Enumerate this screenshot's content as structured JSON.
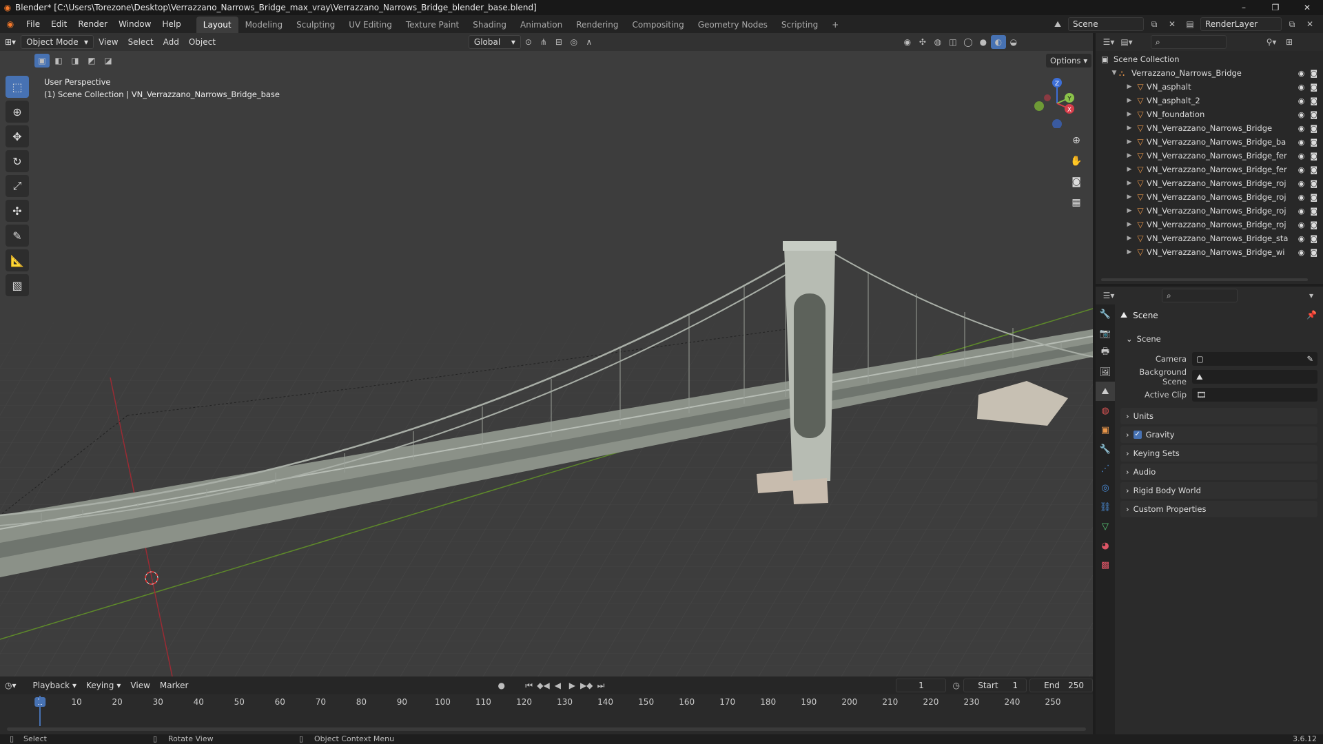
{
  "window": {
    "title": "Blender* [C:\\Users\\Torezone\\Desktop\\Verrazzano_Narrows_Bridge_max_vray\\Verrazzano_Narrows_Bridge_blender_base.blend]",
    "controls": [
      "–",
      "❐",
      "✕"
    ]
  },
  "menubar": {
    "items": [
      "File",
      "Edit",
      "Render",
      "Window",
      "Help"
    ],
    "workspaces": [
      "Layout",
      "Modeling",
      "Sculpting",
      "UV Editing",
      "Texture Paint",
      "Shading",
      "Animation",
      "Rendering",
      "Compositing",
      "Geometry Nodes",
      "Scripting"
    ],
    "active_workspace": "Layout",
    "add_tab": "+",
    "scene_name": "Scene",
    "view_layer": "RenderLayer"
  },
  "viewport": {
    "mode": "Object Mode",
    "menus": [
      "View",
      "Select",
      "Add",
      "Object"
    ],
    "orientation": "Global",
    "options_label": "Options",
    "overlay_line1": "User Perspective",
    "overlay_line2": "(1) Scene Collection | VN_Verrazzano_Narrows_Bridge_base",
    "gizmo_axes": {
      "x": "X",
      "y": "Y",
      "z": "Z"
    }
  },
  "toolbar": {
    "tools": [
      "select-box",
      "cursor",
      "move",
      "rotate",
      "scale",
      "transform",
      "annotate",
      "measure",
      "add-cube"
    ]
  },
  "outliner": {
    "root": "Scene Collection",
    "collection": "Verrazzano_Narrows_Bridge",
    "objects": [
      "VN_asphalt",
      "VN_asphalt_2",
      "VN_foundation",
      "VN_Verrazzano_Narrows_Bridge",
      "VN_Verrazzano_Narrows_Bridge_ba",
      "VN_Verrazzano_Narrows_Bridge_fer",
      "VN_Verrazzano_Narrows_Bridge_fer",
      "VN_Verrazzano_Narrows_Bridge_roj",
      "VN_Verrazzano_Narrows_Bridge_roj",
      "VN_Verrazzano_Narrows_Bridge_roj",
      "VN_Verrazzano_Narrows_Bridge_roj",
      "VN_Verrazzano_Narrows_Bridge_sta",
      "VN_Verrazzano_Narrows_Bridge_wi"
    ]
  },
  "properties": {
    "context_title": "Scene",
    "section_scene": "Scene",
    "camera_label": "Camera",
    "camera_value": "",
    "background_label": "Background Scene",
    "background_value": "",
    "clip_label": "Active Clip",
    "clip_value": "",
    "panels": [
      "Units",
      "Gravity",
      "Keying Sets",
      "Audio",
      "Rigid Body World",
      "Custom Properties"
    ]
  },
  "timeline": {
    "menus": [
      "Playback",
      "Keying",
      "View",
      "Marker"
    ],
    "current_frame": "1",
    "start_label": "Start",
    "start_value": "1",
    "end_label": "End",
    "end_value": "250",
    "ticks": [
      "1",
      "10",
      "20",
      "30",
      "40",
      "50",
      "60",
      "70",
      "80",
      "90",
      "100",
      "110",
      "120",
      "130",
      "140",
      "150",
      "160",
      "170",
      "180",
      "190",
      "200",
      "210",
      "220",
      "230",
      "240",
      "250"
    ]
  },
  "statusbar": {
    "select": "Select",
    "rotate": "Rotate View",
    "context": "Object Context Menu",
    "version": "3.6.12"
  }
}
